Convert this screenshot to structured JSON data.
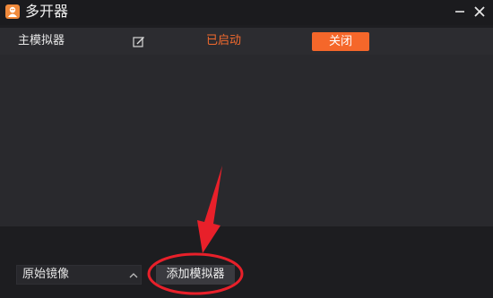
{
  "window": {
    "title": "多开器",
    "icon": "app-logo-icon",
    "controls": [
      "minimize-icon",
      "close-icon"
    ]
  },
  "instances": [
    {
      "name": "主模拟器",
      "edit_icon": "edit-icon",
      "status": "已启动",
      "action_label": "关闭"
    }
  ],
  "footer": {
    "mirror_select": {
      "value": "原始镜像",
      "icon": "chevron-up-icon"
    },
    "add_button_label": "添加模拟器"
  },
  "annotation": {
    "arrow_icon": "red-arrow-icon",
    "highlight": "red-ellipse-around-add-button"
  },
  "colors": {
    "accent": "#f5672a",
    "status": "#f26a2e",
    "annotation": "#e8202a",
    "background": "#1d1d20",
    "row": "#2c2c30"
  }
}
